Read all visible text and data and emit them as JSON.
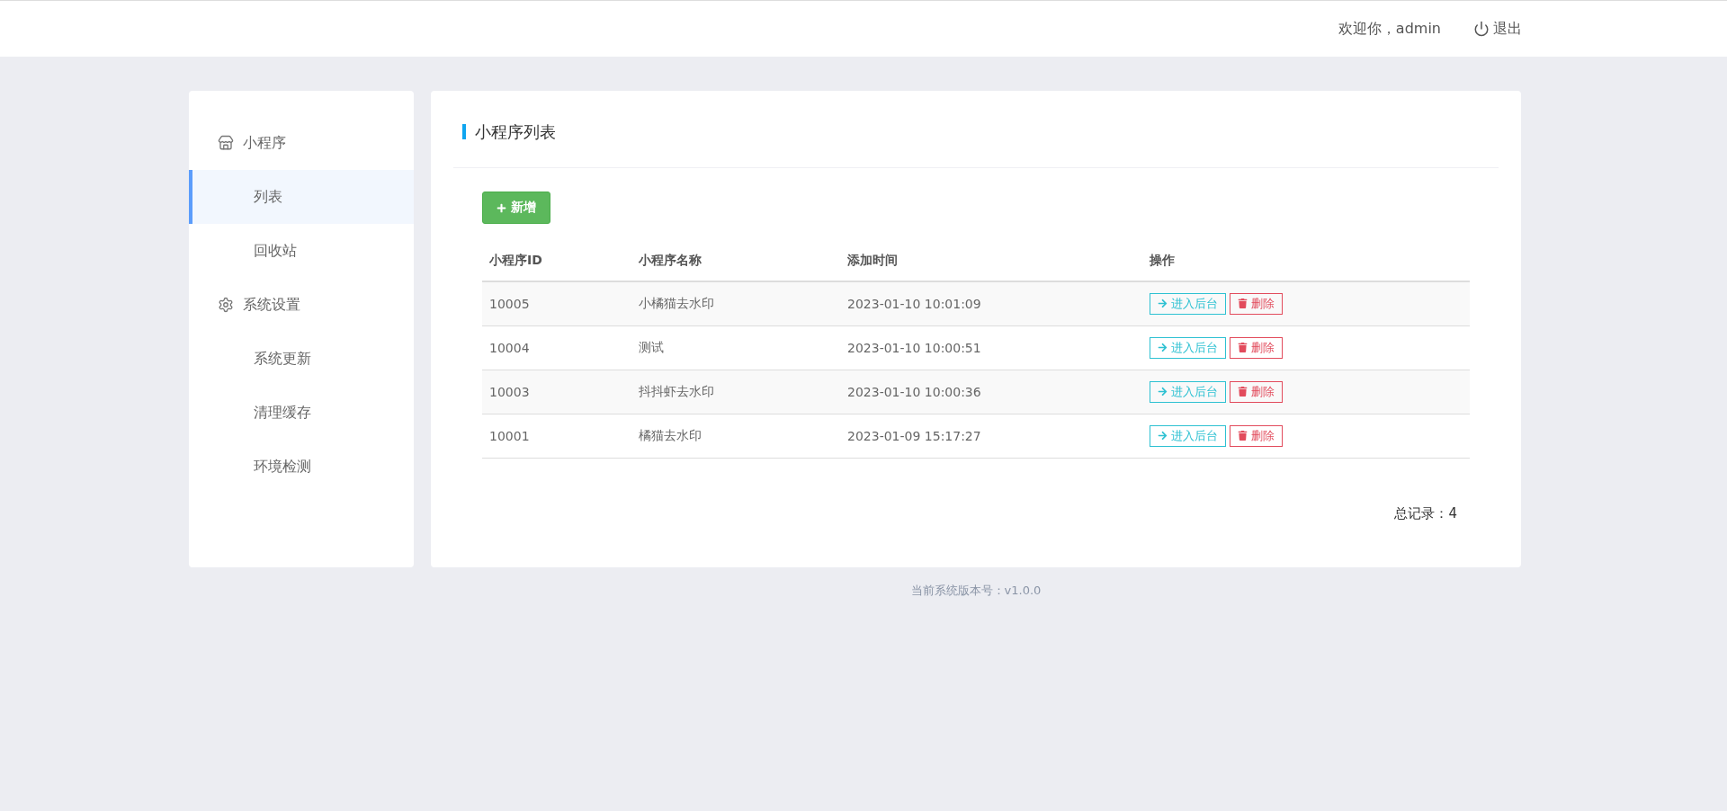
{
  "header": {
    "welcome": "欢迎你，admin",
    "logout": "退出"
  },
  "sidebar": {
    "groups": [
      {
        "label": "小程序",
        "items": [
          {
            "label": "列表",
            "selected": true
          },
          {
            "label": "回收站",
            "selected": false
          }
        ]
      },
      {
        "label": "系统设置",
        "items": [
          {
            "label": "系统更新",
            "selected": false
          },
          {
            "label": "清理缓存",
            "selected": false
          },
          {
            "label": "环境检测",
            "selected": false
          }
        ]
      }
    ]
  },
  "panel": {
    "title": "小程序列表",
    "add_button": "新增",
    "table": {
      "columns": [
        "小程序ID",
        "小程序名称",
        "添加时间",
        "操作"
      ],
      "rows": [
        {
          "id": "10005",
          "name": "小橘猫去水印",
          "time": "2023-01-10 10:01:09",
          "actions": [
            "进入后台",
            "删除"
          ]
        },
        {
          "id": "10004",
          "name": "测试",
          "time": "2023-01-10 10:00:51",
          "actions": [
            "进入后台",
            "删除"
          ]
        },
        {
          "id": "10003",
          "name": "抖抖虾去水印",
          "time": "2023-01-10 10:00:36",
          "actions": [
            "进入后台",
            "删除"
          ]
        },
        {
          "id": "10001",
          "name": "橘猫去水印",
          "time": "2023-01-09 15:17:27",
          "actions": [
            "进入后台",
            "删除"
          ]
        }
      ]
    },
    "total": "总记录：4"
  },
  "footer": "当前系统版本号：v1.0.0"
}
